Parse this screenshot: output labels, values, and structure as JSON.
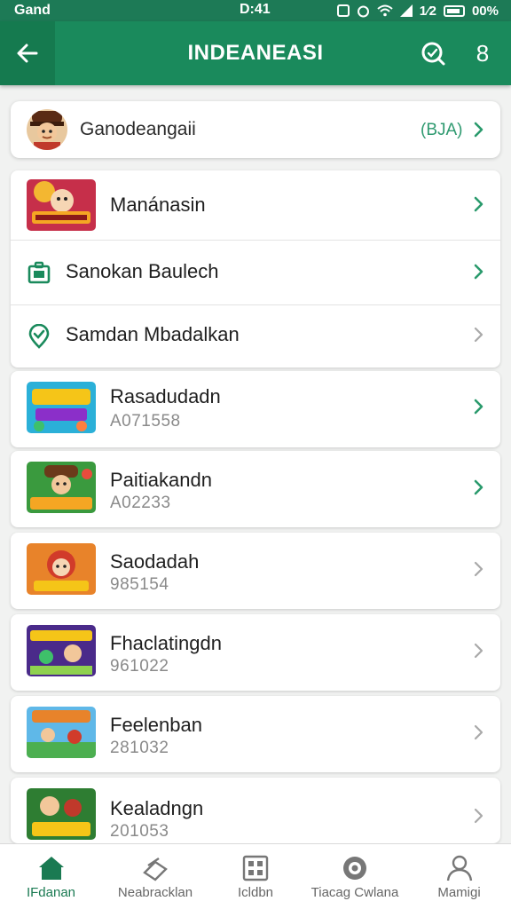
{
  "status_bar": {
    "carrier": "Gand",
    "time": "D:41",
    "icons_text": "1⁄2",
    "battery": "00%"
  },
  "app_bar": {
    "title": "INDEANEASI",
    "back_icon": "arrow-left-icon",
    "search_icon": "search-icon",
    "more_label": "8"
  },
  "profile": {
    "name": "Ganodeangaii",
    "badge": "(BJA)"
  },
  "settings_items": [
    {
      "label": "Manánasin",
      "icon": "game-thumbnail"
    },
    {
      "label": "Sanokan Baulech",
      "icon": "briefcase-icon"
    },
    {
      "label": "Samdan Mbadalkan",
      "icon": "location-check-icon"
    }
  ],
  "games": [
    {
      "title": "Rasadudadn",
      "subtitle": "A071558"
    },
    {
      "title": "Paitiakandn",
      "subtitle": "A02233"
    },
    {
      "title": "Saodadah",
      "subtitle": "985154"
    },
    {
      "title": "Fhaclatingdn",
      "subtitle": "961022"
    },
    {
      "title": "Feelenban",
      "subtitle": "281032"
    },
    {
      "title": "Kealadngn",
      "subtitle": "201053"
    }
  ],
  "bottom_nav": [
    {
      "label": "IFdanan",
      "icon": "home-icon",
      "active": true
    },
    {
      "label": "Neabracklan",
      "icon": "store-icon",
      "active": false
    },
    {
      "label": "Icldbn",
      "icon": "grid-icon",
      "active": false
    },
    {
      "label": "Tiacag Cwlana",
      "icon": "target-icon",
      "active": false
    },
    {
      "label": "Mamigi",
      "icon": "profile-icon",
      "active": false
    }
  ],
  "colors": {
    "primary": "#1a8a5c",
    "primary_dark": "#157a4f",
    "accent_chevron": "#2a9a6c",
    "grey_chevron": "#a9a9a9"
  }
}
